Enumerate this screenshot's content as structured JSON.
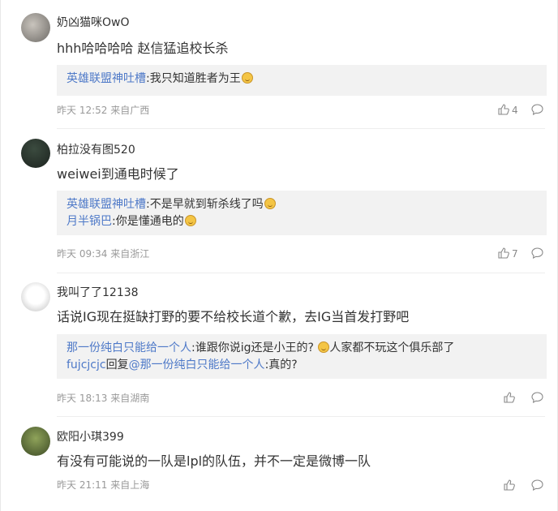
{
  "comments": [
    {
      "username": "奶凶猫咪OwO",
      "text": "hhh哈哈哈哈 赵信猛追校长杀",
      "replies": [
        {
          "parts": [
            {
              "text": "英雄联盟神吐槽",
              "blue": true
            },
            {
              "text": ":我只知道胜者为王",
              "blue": false
            }
          ],
          "emoji": true
        }
      ],
      "meta": "昨天 12:52 来自广西",
      "likes": "4"
    },
    {
      "username": "柏拉没有图520",
      "text": "weiwei到通电时候了",
      "replies": [
        {
          "parts": [
            {
              "text": "英雄联盟神吐槽",
              "blue": true
            },
            {
              "text": ":不是早就到斩杀线了吗",
              "blue": false
            }
          ],
          "emoji": true
        },
        {
          "parts": [
            {
              "text": "月半锅巴",
              "blue": true
            },
            {
              "text": ":你是懂通电的",
              "blue": false
            }
          ],
          "emoji": true
        }
      ],
      "meta": "昨天 09:34 来自浙江",
      "likes": "7"
    },
    {
      "username": "我叫了了12138",
      "text": "话说IG现在挺缺打野的要不给校长道个歉，去IG当首发打野吧",
      "replies": [
        {
          "parts": [
            {
              "text": "那一份纯白只能给一个人",
              "blue": true
            },
            {
              "text": ":谁跟你说ig还是小王的? ",
              "blue": false
            },
            {
              "text": "[emoji]",
              "blue": false,
              "emoji": true
            },
            {
              "text": "人家都不玩这个俱乐部了",
              "blue": false
            }
          ],
          "emoji": false
        },
        {
          "parts": [
            {
              "text": "fujcjcjc",
              "blue": true
            },
            {
              "text": "回复",
              "blue": false
            },
            {
              "text": "@那一份纯白只能给一个人",
              "blue": true
            },
            {
              "text": ":真的?",
              "blue": false
            }
          ],
          "emoji": false
        }
      ],
      "meta": "昨天 18:13 来自湖南",
      "likes": ""
    },
    {
      "username": "欧阳小琪399",
      "text": "有没有可能说的一队是lpl的队伍，并不一定是微博一队",
      "replies": [],
      "meta": "昨天 21:11 来自上海",
      "likes": ""
    }
  ],
  "icons": {
    "like": "thumb-up-icon",
    "comment": "comment-bubble-icon"
  }
}
